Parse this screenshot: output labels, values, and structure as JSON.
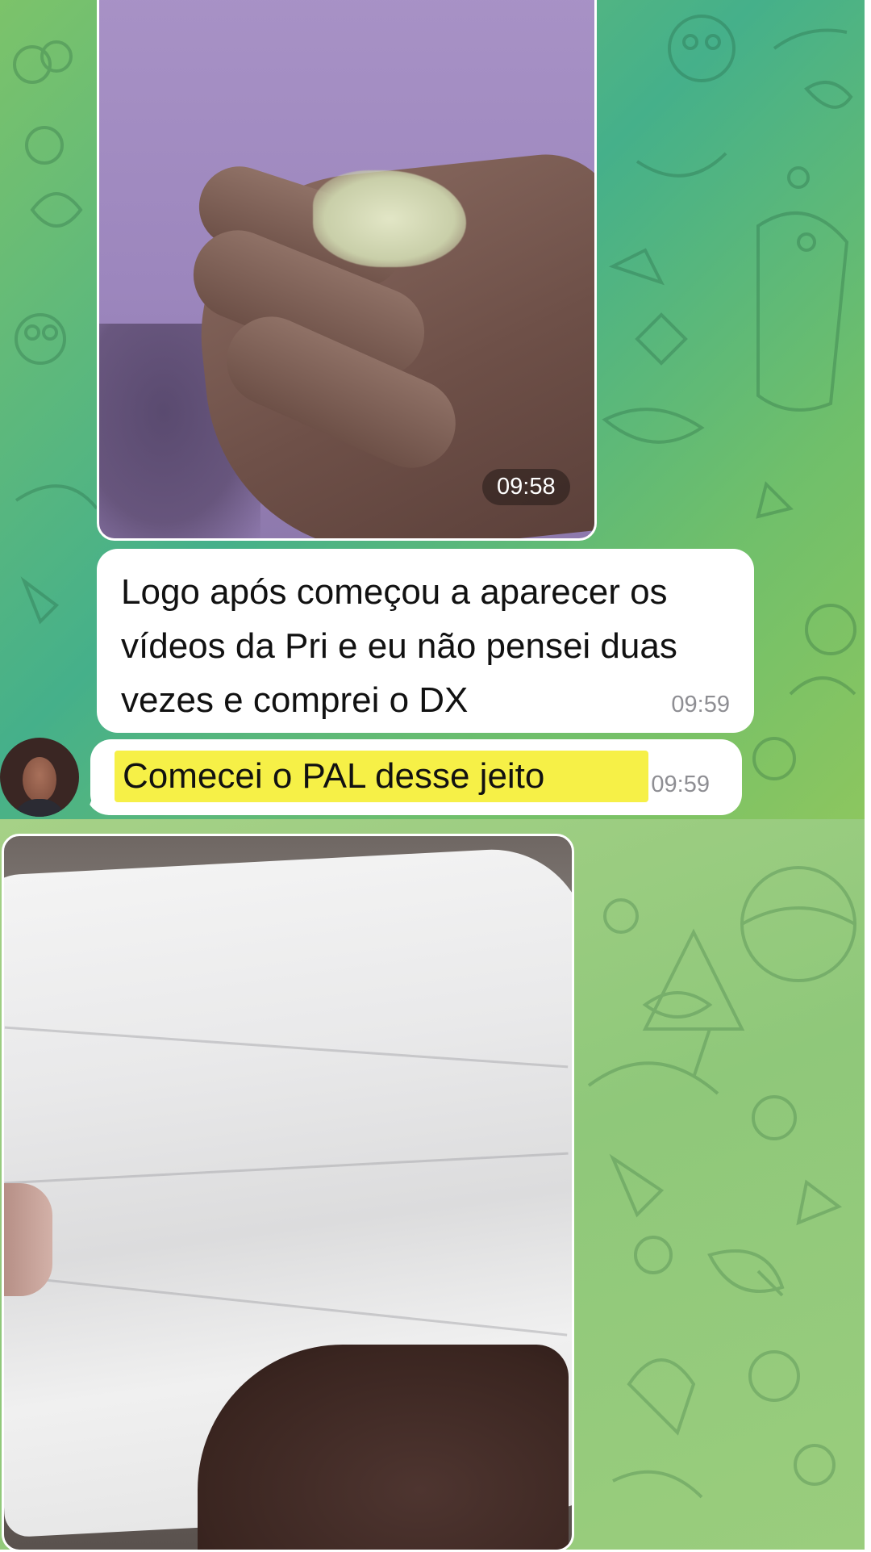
{
  "messages": [
    {
      "type": "photo",
      "description": "hand holding substance",
      "time": "09:58"
    },
    {
      "type": "text",
      "text": "Logo após começou a aparecer os vídeos da Pri e eu não pensei duas vezes e comprei o DX",
      "time": "09:59"
    },
    {
      "type": "text",
      "text": "Comecei o PAL desse jeito",
      "time": "09:59",
      "highlight": "#f6f047"
    },
    {
      "type": "photo",
      "description": "tissue paper"
    }
  ],
  "colors": {
    "chat_bg_top": "#45b08a",
    "chat_bg_bottom": "#9acd7d",
    "bubble": "#ffffff",
    "timestamp": "#8e8e93",
    "highlight": "#f6f047"
  },
  "icons": [
    "avatar"
  ]
}
